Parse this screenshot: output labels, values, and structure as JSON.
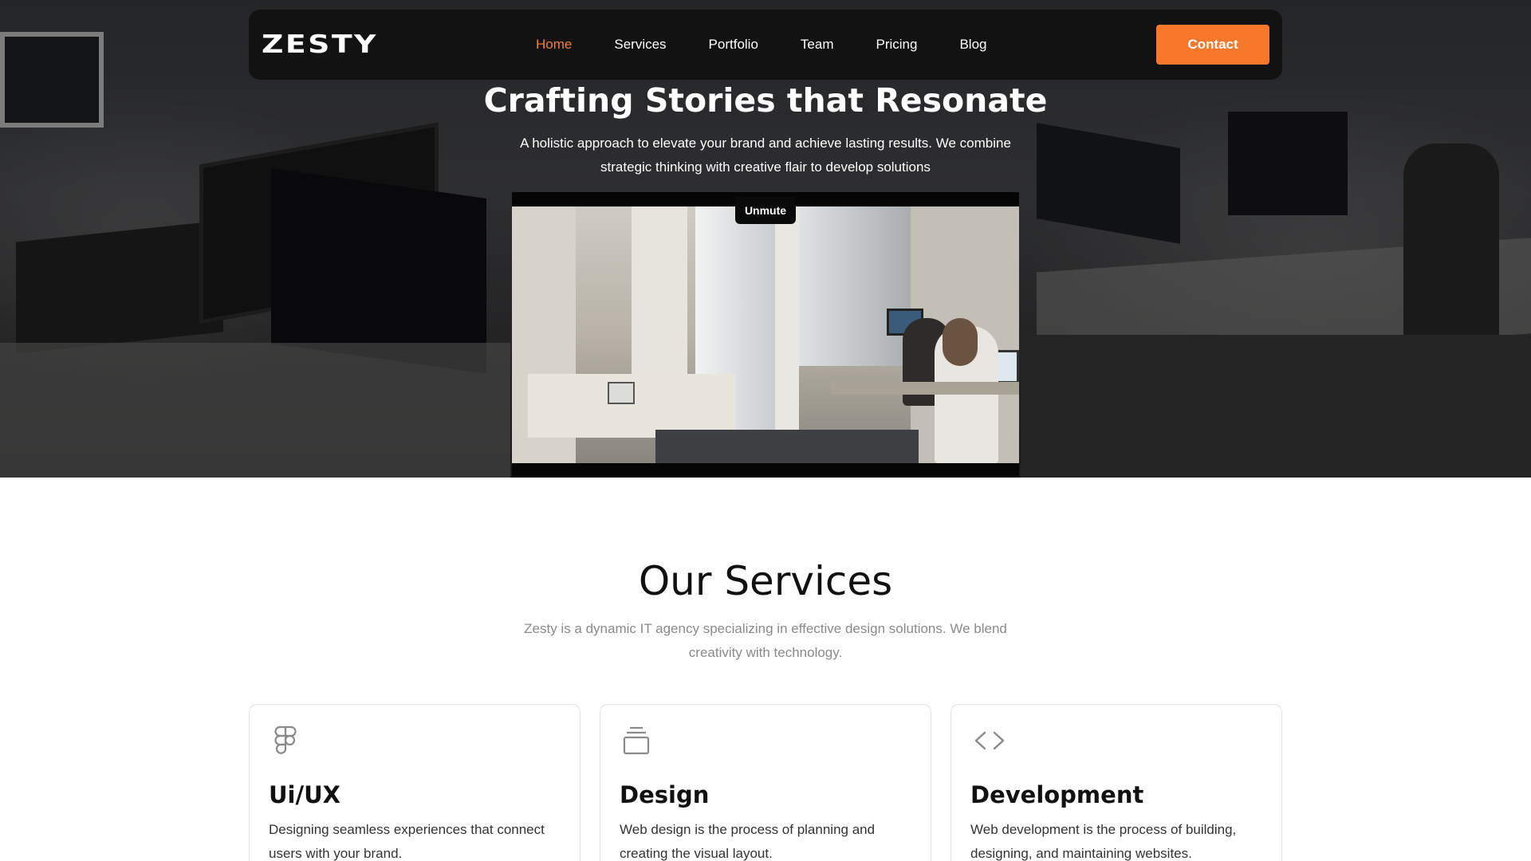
{
  "nav": {
    "logo": "ZESTY",
    "links": [
      {
        "label": "Home",
        "active": true
      },
      {
        "label": "Services",
        "active": false
      },
      {
        "label": "Portfolio",
        "active": false
      },
      {
        "label": "Team",
        "active": false
      },
      {
        "label": "Pricing",
        "active": false
      },
      {
        "label": "Blog",
        "active": false
      }
    ],
    "contact_label": "Contact"
  },
  "hero": {
    "title": "Crafting Stories that Resonate",
    "subtitle": "A holistic approach to elevate your brand and achieve lasting results. We combine strategic thinking with creative flair to develop solutions",
    "video": {
      "unmute_label": "Unmute"
    }
  },
  "services": {
    "title": "Our Services",
    "subtitle": "Zesty is a dynamic IT agency specializing in effective design solutions. We blend creativity with technology.",
    "cards": [
      {
        "icon": "figma-icon",
        "title": "Ui/UX",
        "description": "Designing seamless experiences that connect users with your brand."
      },
      {
        "icon": "layers-icon",
        "title": "Design",
        "description": "Web design is the process of planning and creating the visual layout."
      },
      {
        "icon": "code-icon",
        "title": "Development",
        "description": "Web development is the process of building, designing, and maintaining websites."
      }
    ]
  },
  "colors": {
    "accent": "#f7782a",
    "nav_bg": "#121212",
    "muted_text": "#8a8a8a"
  }
}
